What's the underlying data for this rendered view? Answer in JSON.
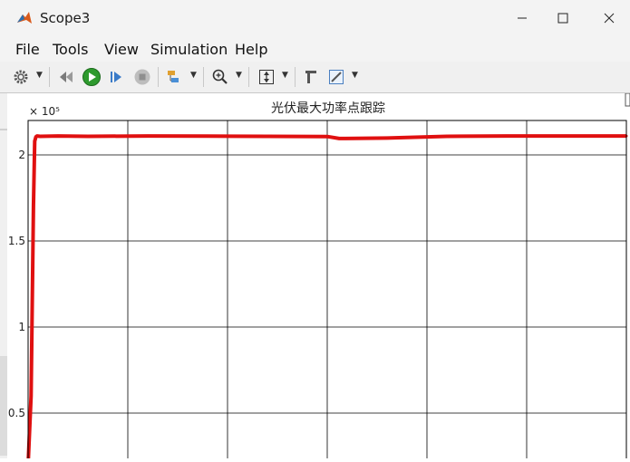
{
  "window": {
    "title": "Scope3",
    "minimize_glyph": "—",
    "maximize_glyph": "☐",
    "close_glyph": "✕"
  },
  "menu": {
    "items": [
      "File",
      "Tools",
      "View",
      "Simulation",
      "Help"
    ]
  },
  "toolbar": {
    "icons": [
      "gear-icon",
      "step-back-icon",
      "run-icon",
      "step-forward-icon",
      "stop-icon",
      "signal-select-icon",
      "zoom-icon",
      "scale-axes-icon",
      "cursor-icon",
      "edit-icon"
    ]
  },
  "colors": {
    "signal": "#e01010",
    "run": "#2e9a2e",
    "grid": "#000000"
  },
  "chart_data": {
    "type": "line",
    "title": "光伏最大功率点跟踪",
    "y_exponent_label": "× 10⁵",
    "y_tick_labels": [
      "2",
      "1.5",
      "1",
      "0.5"
    ],
    "y_ticks": [
      200000,
      150000,
      100000,
      50000
    ],
    "ylim": [
      20000,
      220000
    ],
    "grid": true,
    "series": [
      {
        "x": [
          0,
          0.005,
          0.009,
          0.011,
          0.013,
          0.015,
          0.02,
          0.05,
          0.1,
          0.2,
          0.3,
          0.4,
          0.5,
          0.52,
          0.6,
          0.7,
          0.8,
          0.9,
          1.0
        ],
        "values": [
          20000,
          60000,
          170000,
          208000,
          210500,
          211000,
          210800,
          211000,
          210800,
          211000,
          210900,
          210800,
          210700,
          209500,
          209800,
          210800,
          211000,
          211000,
          211000
        ]
      }
    ]
  }
}
